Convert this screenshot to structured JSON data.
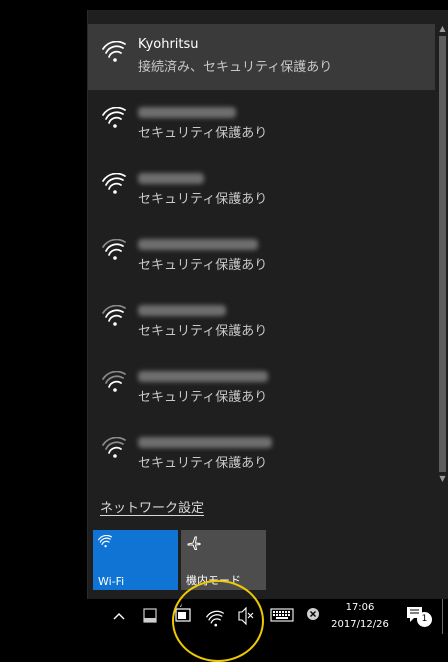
{
  "networks": [
    {
      "ssid": "Kyohritsu",
      "status": "接続済み、セキュリティ保護あり",
      "connected": true,
      "ssid_blurred": false
    },
    {
      "ssid": "",
      "status": "セキュリティ保護あり",
      "connected": false,
      "ssid_blurred": true
    },
    {
      "ssid": "",
      "status": "セキュリティ保護あり",
      "connected": false,
      "ssid_blurred": true
    },
    {
      "ssid": "",
      "status": "セキュリティ保護あり",
      "connected": false,
      "ssid_blurred": true
    },
    {
      "ssid": "",
      "status": "セキュリティ保護あり",
      "connected": false,
      "ssid_blurred": true
    },
    {
      "ssid": "",
      "status": "セキュリティ保護あり",
      "connected": false,
      "ssid_blurred": true
    },
    {
      "ssid": "",
      "status": "セキュリティ保護あり",
      "connected": false,
      "ssid_blurred": true
    }
  ],
  "network_settings_label": "ネットワーク設定",
  "quick_actions": {
    "wifi_label": "Wi-Fi",
    "airplane_label": "機内モード"
  },
  "taskbar": {
    "time": "17:06",
    "date": "2017/12/26",
    "notification_count": "1"
  },
  "colors": {
    "accent": "#0f74d4",
    "highlight_circle": "#f0c800"
  }
}
